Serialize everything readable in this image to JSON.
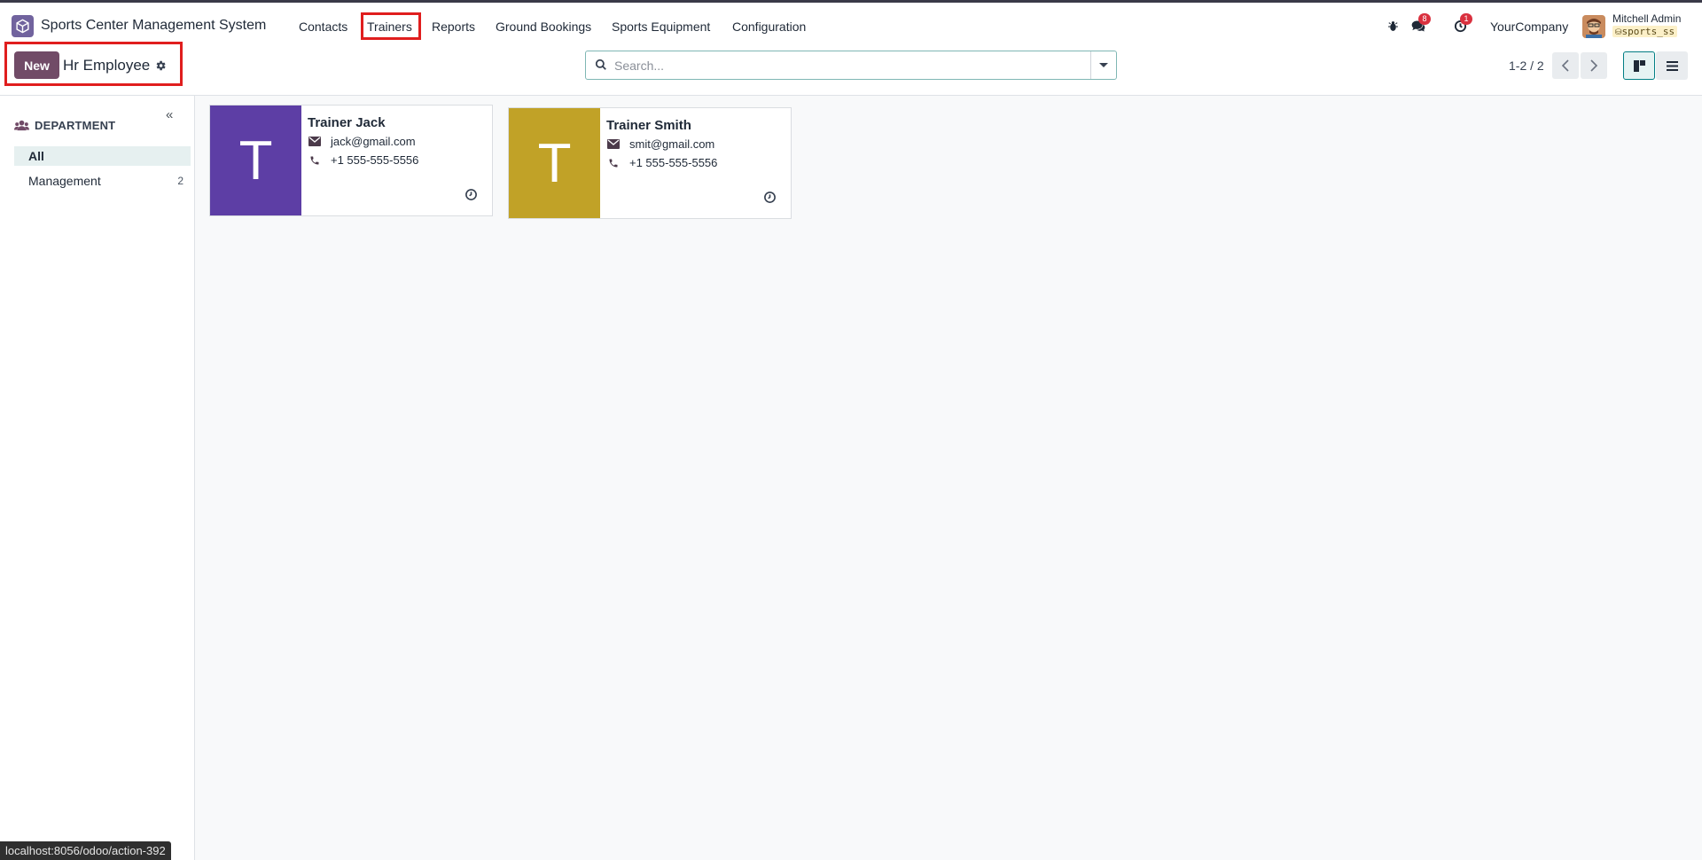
{
  "navbar": {
    "app_name": "Sports Center Management System",
    "menu": [
      "Contacts",
      "Trainers",
      "Reports",
      "Ground Bookings",
      "Sports Equipment",
      "Configuration"
    ],
    "messages_badge": "8",
    "activities_badge": "1",
    "company": "YourCompany",
    "user_name": "Mitchell Admin",
    "db_name": "sports_ss"
  },
  "control_panel": {
    "new_label": "New",
    "breadcrumb": "Hr Employee",
    "search_placeholder": "Search...",
    "pager": "1-2 / 2"
  },
  "sidepanel": {
    "title": "DEPARTMENT",
    "items": [
      {
        "label": "All",
        "count": ""
      },
      {
        "label": "Management",
        "count": "2"
      }
    ]
  },
  "cards": [
    {
      "initial": "T",
      "name": "Trainer Jack",
      "email": "jack@gmail.com",
      "phone": "+1 555-555-5556",
      "color": "#5d3ea5"
    },
    {
      "initial": "T",
      "name": "Trainer Smith",
      "email": "smit@gmail.com",
      "phone": "+1 555-555-5556",
      "color": "#c1a227"
    }
  ],
  "statusbar": "localhost:8056/odoo/action-392",
  "colors": {
    "primary": "#714b67",
    "highlight": "#e01e1e"
  }
}
